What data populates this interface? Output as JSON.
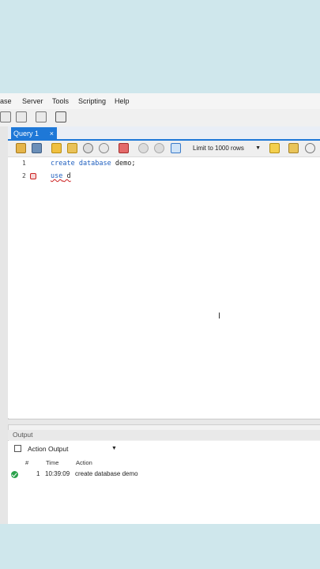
{
  "menubar": {
    "items": [
      "ase",
      "Server",
      "Tools",
      "Scripting",
      "Help"
    ]
  },
  "tabs": [
    {
      "label": "Query 1",
      "close": "×"
    }
  ],
  "query_toolbar": {
    "limit_label": "Limit to 1000 rows"
  },
  "editor": {
    "lines": [
      {
        "number": "1",
        "keyword": "create database",
        "rest": " demo;"
      },
      {
        "number": "2",
        "keyword": "use",
        "rest": " d"
      }
    ]
  },
  "output": {
    "title": "Output",
    "select_value": "Action Output",
    "columns": [
      "#",
      "Time",
      "Action"
    ],
    "rows": [
      {
        "num": "1",
        "time": "10:39:09",
        "action": "create database demo"
      }
    ]
  },
  "colors": {
    "accent": "#1e78d7",
    "success": "#2aa14a",
    "error": "#cc2222",
    "keyword": "#1f5fbf"
  }
}
